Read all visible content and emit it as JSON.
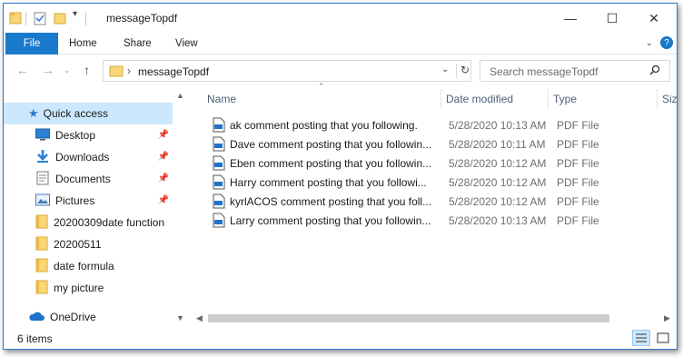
{
  "window": {
    "title": "messageTopdf",
    "controls": {
      "minimize": "—",
      "maximize": "☐",
      "close": "✕"
    }
  },
  "ribbon": {
    "tabs": [
      "File",
      "Home",
      "Share",
      "View"
    ],
    "help_icon": "?"
  },
  "address": {
    "path_separator": "›",
    "path": "messageTopdf",
    "search_placeholder": "Search messageTopdf"
  },
  "sidebar": {
    "items": [
      {
        "label": "Quick access",
        "icon": "star-icon",
        "selected": true
      },
      {
        "label": "Desktop",
        "icon": "desktop-icon",
        "pinned": true
      },
      {
        "label": "Downloads",
        "icon": "download-icon",
        "pinned": true
      },
      {
        "label": "Documents",
        "icon": "documents-icon",
        "pinned": true
      },
      {
        "label": "Pictures",
        "icon": "pictures-icon",
        "pinned": true
      },
      {
        "label": "20200309date function",
        "icon": "folder-icon"
      },
      {
        "label": "20200511",
        "icon": "folder-icon"
      },
      {
        "label": "date formula",
        "icon": "folder-icon"
      },
      {
        "label": "my picture",
        "icon": "folder-icon"
      },
      {
        "label": "OneDrive",
        "icon": "cloud-icon"
      }
    ]
  },
  "columns": {
    "name": "Name",
    "date": "Date modified",
    "type": "Type",
    "size": "Siz"
  },
  "files": [
    {
      "name": "ak comment posting that you following.",
      "date": "5/28/2020 10:13 AM",
      "type": "PDF File"
    },
    {
      "name": "Dave comment posting that you followin...",
      "date": "5/28/2020 10:11 AM",
      "type": "PDF File"
    },
    {
      "name": "Eben comment posting that you followin...",
      "date": "5/28/2020 10:12 AM",
      "type": "PDF File"
    },
    {
      "name": "Harry comment posting that you followi...",
      "date": "5/28/2020 10:12 AM",
      "type": "PDF File"
    },
    {
      "name": "kyrlACOS comment posting that you foll...",
      "date": "5/28/2020 10:12 AM",
      "type": "PDF File"
    },
    {
      "name": "Larry comment posting that you followin...",
      "date": "5/28/2020 10:13 AM",
      "type": "PDF File"
    }
  ],
  "status": {
    "item_count": "6 items"
  },
  "colors": {
    "accent": "#1979ca",
    "selected_bg": "#cce8ff",
    "folder_yellow": "#f8d775"
  }
}
